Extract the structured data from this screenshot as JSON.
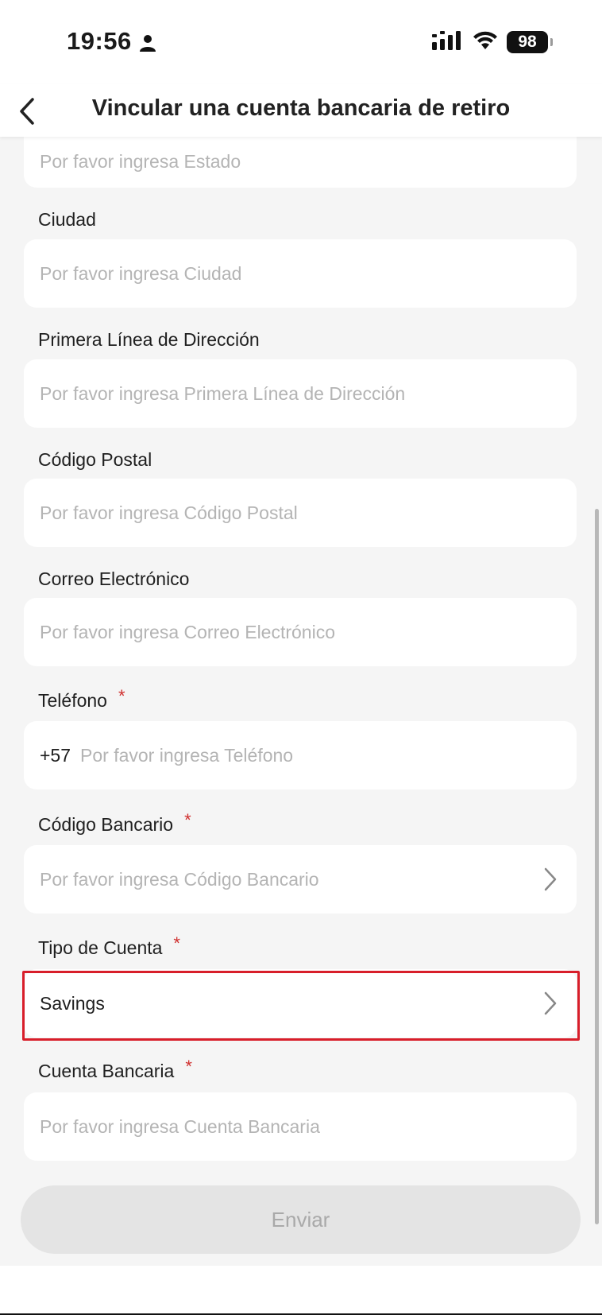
{
  "status_bar": {
    "time": "19:56",
    "battery": "98",
    "icons": [
      "person-icon",
      "signal-icon",
      "wifi-icon",
      "battery-icon"
    ]
  },
  "header": {
    "title": "Vincular una cuenta bancaria de retiro",
    "back_icon": "chevron-left-icon"
  },
  "form": {
    "estado": {
      "placeholder": "Por favor ingresa Estado"
    },
    "ciudad": {
      "label": "Ciudad",
      "placeholder": "Por favor ingresa Ciudad"
    },
    "direccion": {
      "label": "Primera Línea de Dirección",
      "placeholder": "Por favor ingresa Primera Línea de Dirección"
    },
    "codigo_postal": {
      "label": "Código Postal",
      "placeholder": "Por favor ingresa Código Postal"
    },
    "correo": {
      "label": "Correo Electrónico",
      "placeholder": "Por favor ingresa Correo Electrónico"
    },
    "telefono": {
      "label": "Teléfono",
      "required_mark": "*",
      "prefix": "+57",
      "placeholder": "Por favor ingresa Teléfono"
    },
    "codigo_bancario": {
      "label": "Código Bancario",
      "required_mark": "*",
      "placeholder": "Por favor ingresa Código Bancario"
    },
    "tipo_cuenta": {
      "label": "Tipo de Cuenta",
      "required_mark": "*",
      "value": "Savings"
    },
    "cuenta_bancaria": {
      "label": "Cuenta Bancaria",
      "required_mark": "*",
      "placeholder": "Por favor ingresa Cuenta Bancaria"
    }
  },
  "submit": {
    "label": "Enviar"
  },
  "colors": {
    "required": "#d0302f",
    "highlight_border": "#d81e2a",
    "page_background": "#f5f5f5",
    "placeholder": "#b4b4b4",
    "button_disabled_bg": "#e4e4e4",
    "button_disabled_text": "#a9a9a9"
  }
}
